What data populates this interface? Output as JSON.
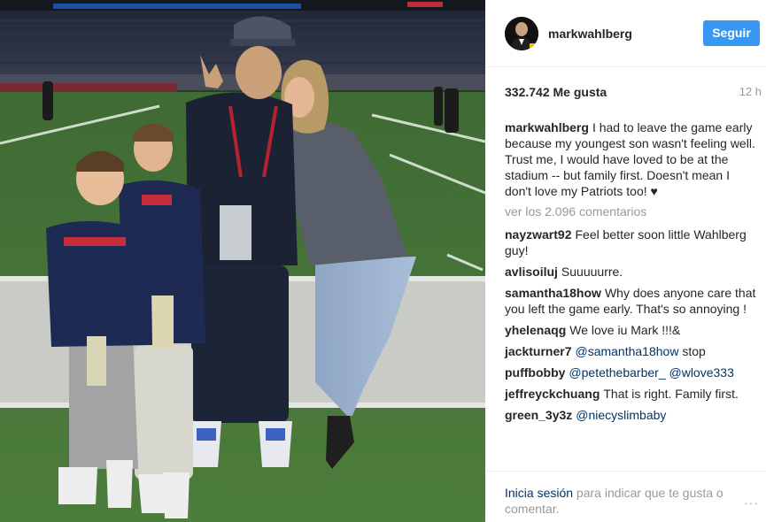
{
  "post": {
    "photo_icon": "post-photo",
    "header": {
      "username": "markwahlberg",
      "follow_label": "Seguir"
    },
    "likes": "332.742 Me gusta",
    "time": "12 h",
    "caption": {
      "username": "markwahlberg",
      "text": "I had to leave the game early because my youngest son wasn't feeling well. Trust me, I would have loved to be at the stadium -- but family first. Doesn't mean I don't love my Patriots too! ♥"
    },
    "view_all": "ver los 2.096 comentarios",
    "comments": [
      {
        "username": "nayzwart92",
        "text": "Feel better soon little Wahlberg guy!"
      },
      {
        "username": "avlisoiluj",
        "text": "Suuuuurre."
      },
      {
        "username": "samantha18how",
        "text": "Why does anyone care that you left the game early. That's so annoying !"
      },
      {
        "username": "yhelenaqg",
        "text": "We love iu Mark !!!&"
      },
      {
        "username": "jackturner7",
        "mention": "@samantha18how",
        "text": " stop"
      },
      {
        "username": "puffbobby",
        "mention": "@petethebarber_",
        "mention2": "@wlove333"
      },
      {
        "username": "jeffreyckchuang",
        "text": "That is right. Family first."
      },
      {
        "username": "green_3y3z",
        "mention": "@niecyslimbaby"
      }
    ],
    "footer": {
      "login_link": "Inicia sesión",
      "login_text": " para indicar que te gusta o comentar.",
      "more": "···"
    },
    "colors": {
      "follow_button": "#3897f0",
      "mention": "#003569",
      "muted": "#999999",
      "text": "#262626"
    }
  }
}
